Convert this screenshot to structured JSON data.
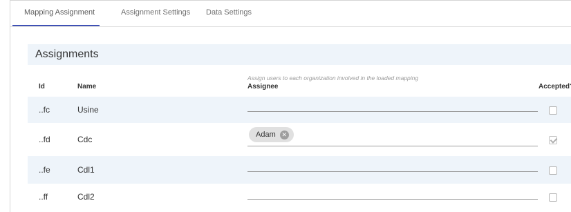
{
  "tabs": [
    {
      "label": "Mapping Assignment",
      "active": true
    },
    {
      "label": "Assignment Settings",
      "active": false
    },
    {
      "label": "Data Settings",
      "active": false
    }
  ],
  "panel": {
    "title": "Assignments",
    "hint": "Assign users to each organization involved in the loaded mapping"
  },
  "columns": {
    "id": "Id",
    "name": "Name",
    "assignee": "Assignee",
    "accepted": "Accepted?"
  },
  "rows": [
    {
      "id": "..fc",
      "name": "Usine",
      "assignee": "",
      "accepted": false
    },
    {
      "id": "..fd",
      "name": "Cdc",
      "assignee": "Adam",
      "accepted": true
    },
    {
      "id": "..fe",
      "name": "Cdl1",
      "assignee": "",
      "accepted": false
    },
    {
      "id": "..ff",
      "name": "Cdl2",
      "assignee": "",
      "accepted": false
    }
  ],
  "colors": {
    "accent": "#3f51b5",
    "row_shade": "#eef4fa",
    "chip_bg": "#e0e0e0"
  },
  "icons": {
    "chip_remove": "close-circle-icon"
  }
}
